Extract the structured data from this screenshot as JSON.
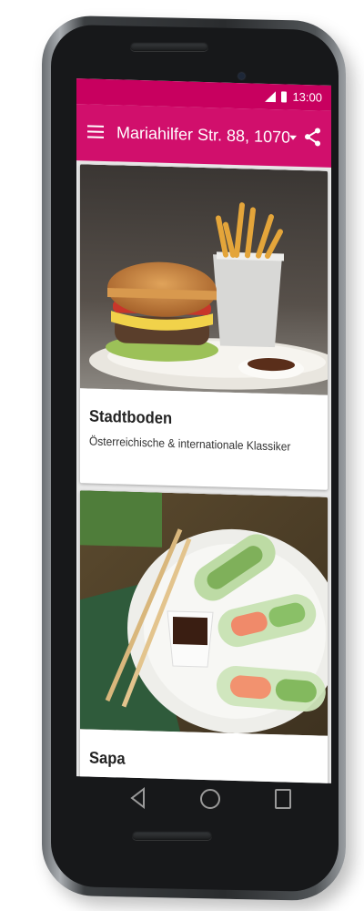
{
  "status_bar": {
    "time": "13:00"
  },
  "app_bar": {
    "title": "Mariahilfer Str. 88, 1070..."
  },
  "restaurants": [
    {
      "name": "Stadtboden",
      "description": "Österreichische & internationale Klassiker"
    },
    {
      "name": "Sapa",
      "description": ""
    }
  ],
  "colors": {
    "accent": "#d10f6c",
    "status": "#c8005f"
  },
  "icons": [
    "menu-icon",
    "dropdown-icon",
    "share-icon",
    "signal-icon",
    "battery-icon",
    "back-icon",
    "home-icon",
    "recents-icon"
  ]
}
